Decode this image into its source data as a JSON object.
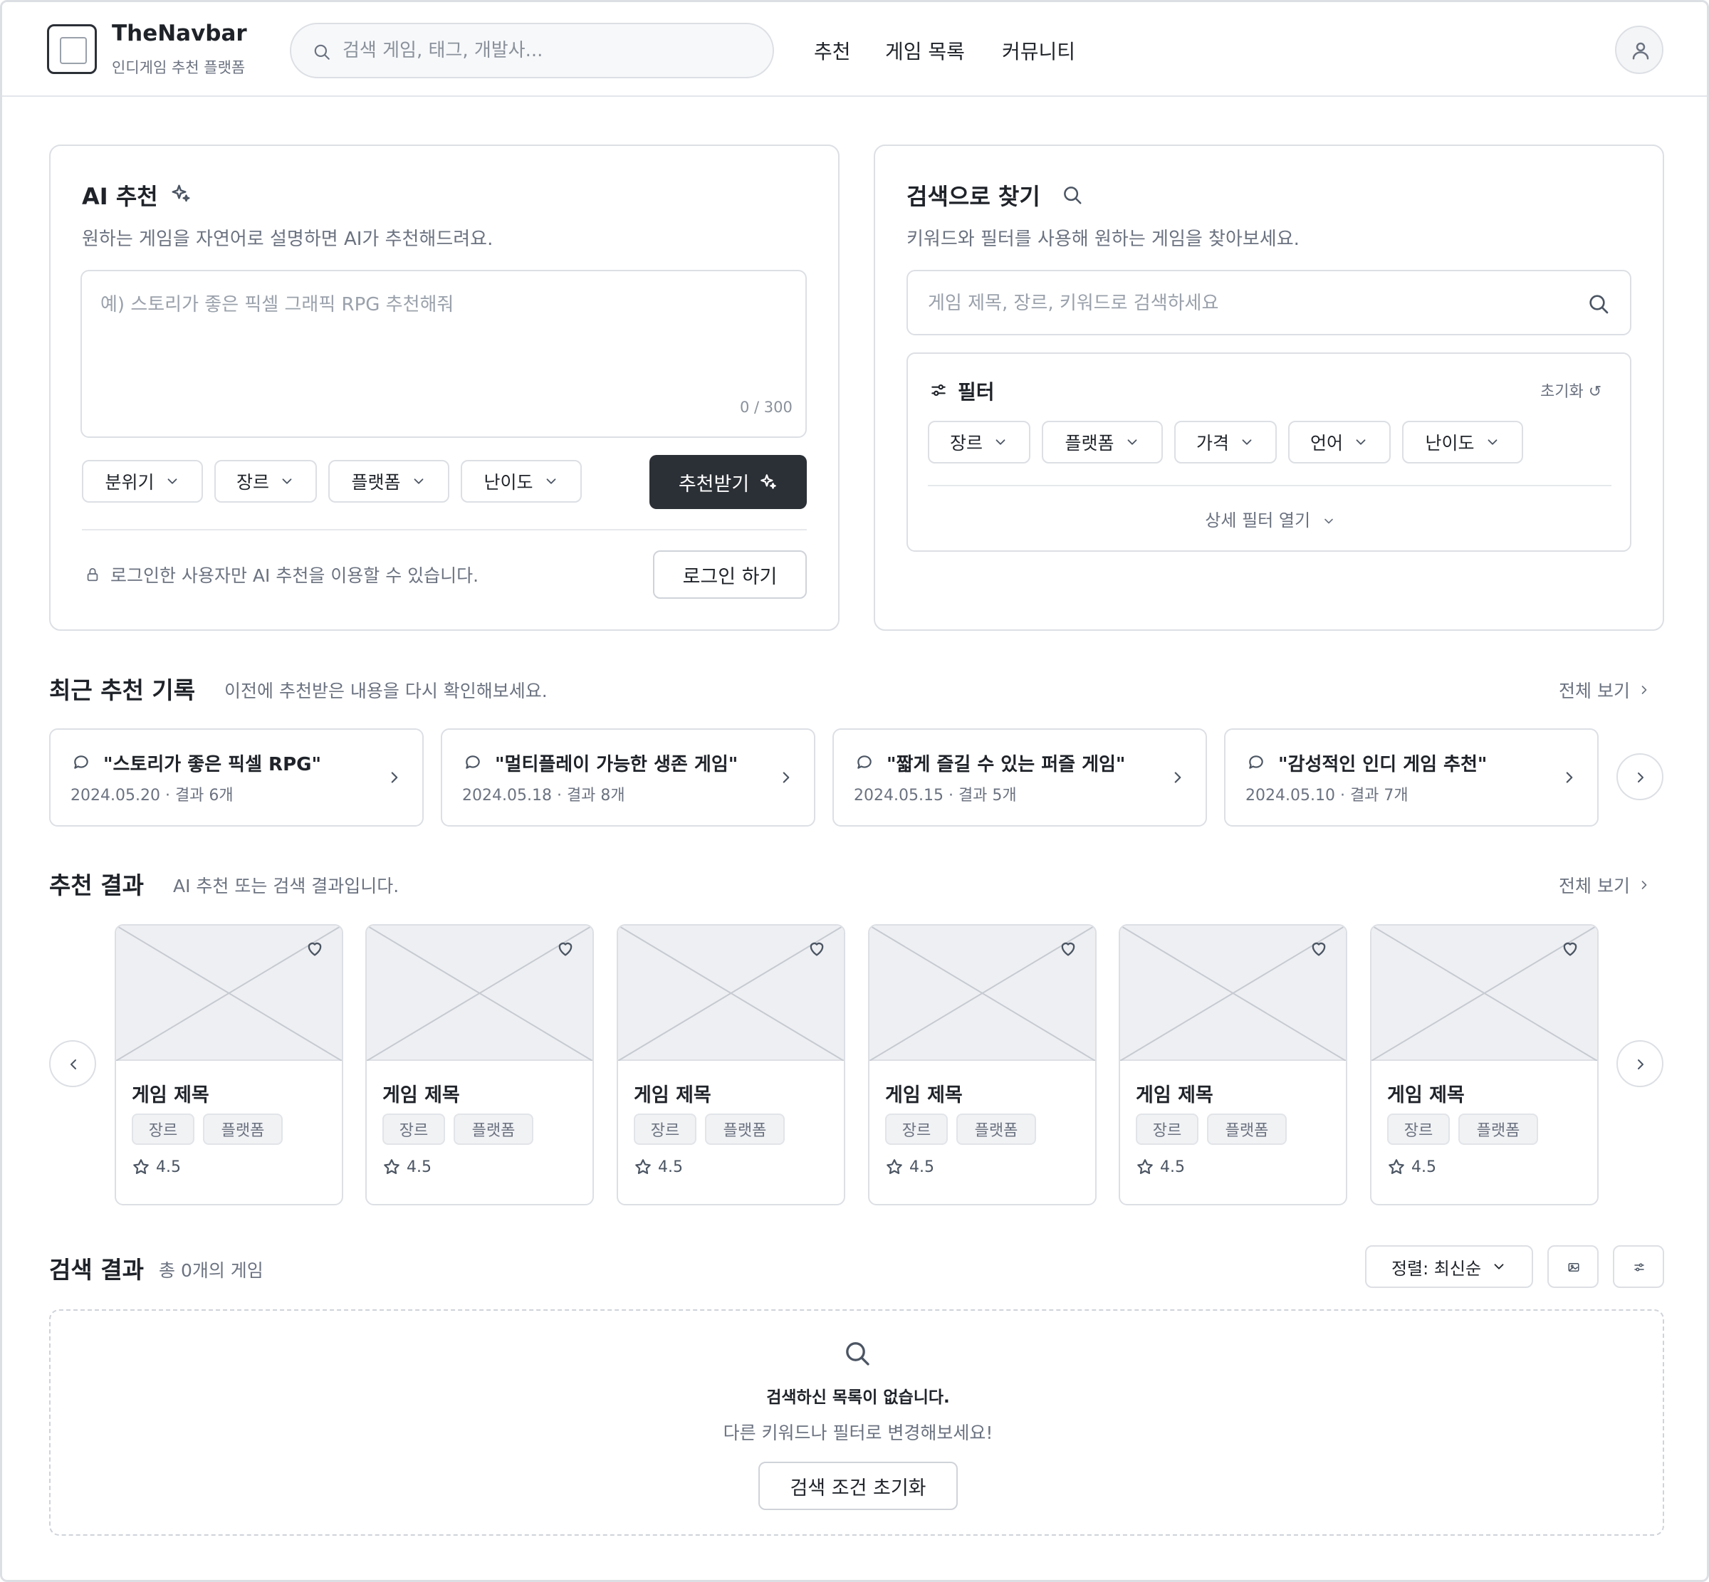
{
  "header": {
    "brand": "TheNavbar",
    "brand_sub": "인디게임 추천 플랫폼",
    "search_placeholder": "검색 게임, 태그, 개발사...",
    "nav": [
      "추천",
      "게임 목록",
      "커뮤니티"
    ]
  },
  "ai_panel": {
    "title": "AI 추천",
    "subtitle": "원하는 게임을 자연어로 설명하면 AI가 추천해드려요.",
    "input_placeholder": "예) 스토리가 좋은 픽셀 그래픽 RPG 추천해줘",
    "counter": "0 / 300",
    "selects": [
      "분위기",
      "장르",
      "플랫폼",
      "난이도"
    ],
    "submit_label": "추천받기",
    "login_note": "로그인한 사용자만 AI 추천을 이용할 수 있습니다.",
    "login_button": "로그인 하기"
  },
  "search_panel": {
    "title": "검색으로 찾기",
    "subtitle": "키워드와 필터를 사용해 원하는 게임을 찾아보세요.",
    "input_placeholder": "게임 제목, 장르, 키워드로 검색하세요",
    "filter_title": "필터",
    "reset_label": "초기화 ↺",
    "filters": [
      "장르",
      "플랫폼",
      "가격",
      "언어",
      "난이도"
    ],
    "more_filters": "상세 필터 열기"
  },
  "history": {
    "title": "최근 추천 기록",
    "subtitle": "이전에 추천받은 내용을 다시 확인해보세요.",
    "see_all": "전체 보기",
    "items": [
      {
        "query": "\"스토리가 좋은 픽셀 RPG\"",
        "meta": "2024.05.20 · 결과 6개"
      },
      {
        "query": "\"멀티플레이 가능한 생존 게임\"",
        "meta": "2024.05.18 · 결과 8개"
      },
      {
        "query": "\"짧게 즐길 수 있는 퍼즐 게임\"",
        "meta": "2024.05.15 · 결과 5개"
      },
      {
        "query": "\"감성적인 인디 게임 추천\"",
        "meta": "2024.05.10 · 결과 7개"
      }
    ]
  },
  "results": {
    "title": "추천 결과",
    "subtitle": "AI 추천 또는 검색 결과입니다.",
    "see_all": "전체 보기",
    "cards": [
      {
        "title": "게임 제목",
        "tags": [
          "장르",
          "플랫폼"
        ],
        "rating": "4.5"
      },
      {
        "title": "게임 제목",
        "tags": [
          "장르",
          "플랫폼"
        ],
        "rating": "4.5"
      },
      {
        "title": "게임 제목",
        "tags": [
          "장르",
          "플랫폼"
        ],
        "rating": "4.5"
      },
      {
        "title": "게임 제목",
        "tags": [
          "장르",
          "플랫폼"
        ],
        "rating": "4.5"
      },
      {
        "title": "게임 제목",
        "tags": [
          "장르",
          "플랫폼"
        ],
        "rating": "4.5"
      },
      {
        "title": "게임 제목",
        "tags": [
          "장르",
          "플랫폼"
        ],
        "rating": "4.5"
      }
    ]
  },
  "search_results": {
    "title": "검색 결과",
    "count": "총 0개의 게임",
    "sort_label": "정렬: 최신순",
    "empty_title": "검색하신 목록이 없습니다.",
    "empty_sub": "다른 키워드나 필터로 변경해보세요!",
    "reset_button": "검색 조건 초기화"
  },
  "colors": {
    "primary_button": "#2b2f36",
    "border": "#dcdfe4",
    "muted_text": "#6b7280"
  }
}
